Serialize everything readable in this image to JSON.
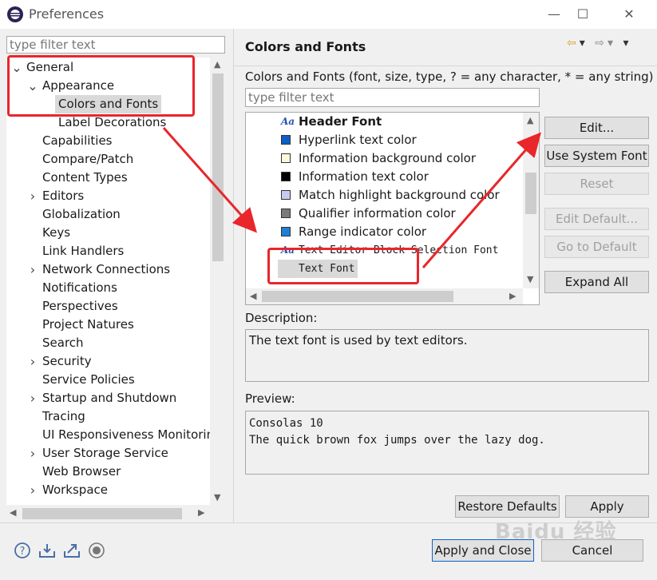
{
  "window": {
    "title": "Preferences",
    "minimize": "—",
    "maximize": "☐",
    "close": "✕"
  },
  "left": {
    "filter_placeholder": "type filter text",
    "tree": [
      {
        "label": "General",
        "depth": 0,
        "expander": "open"
      },
      {
        "label": "Appearance",
        "depth": 1,
        "expander": "open"
      },
      {
        "label": "Colors and Fonts",
        "depth": 2,
        "expander": "none",
        "selected": true
      },
      {
        "label": "Label Decorations",
        "depth": 2,
        "expander": "none"
      },
      {
        "label": "Capabilities",
        "depth": 1,
        "expander": "none"
      },
      {
        "label": "Compare/Patch",
        "depth": 1,
        "expander": "none"
      },
      {
        "label": "Content Types",
        "depth": 1,
        "expander": "none"
      },
      {
        "label": "Editors",
        "depth": 1,
        "expander": "closed"
      },
      {
        "label": "Globalization",
        "depth": 1,
        "expander": "none"
      },
      {
        "label": "Keys",
        "depth": 1,
        "expander": "none"
      },
      {
        "label": "Link Handlers",
        "depth": 1,
        "expander": "none"
      },
      {
        "label": "Network Connections",
        "depth": 1,
        "expander": "closed"
      },
      {
        "label": "Notifications",
        "depth": 1,
        "expander": "none"
      },
      {
        "label": "Perspectives",
        "depth": 1,
        "expander": "none"
      },
      {
        "label": "Project Natures",
        "depth": 1,
        "expander": "none"
      },
      {
        "label": "Search",
        "depth": 1,
        "expander": "none"
      },
      {
        "label": "Security",
        "depth": 1,
        "expander": "closed"
      },
      {
        "label": "Service Policies",
        "depth": 1,
        "expander": "none"
      },
      {
        "label": "Startup and Shutdown",
        "depth": 1,
        "expander": "closed"
      },
      {
        "label": "Tracing",
        "depth": 1,
        "expander": "none"
      },
      {
        "label": "UI Responsiveness Monitoring",
        "depth": 1,
        "expander": "none"
      },
      {
        "label": "User Storage Service",
        "depth": 1,
        "expander": "closed"
      },
      {
        "label": "Web Browser",
        "depth": 1,
        "expander": "none"
      },
      {
        "label": "Workspace",
        "depth": 1,
        "expander": "closed"
      }
    ]
  },
  "page": {
    "title": "Colors and Fonts",
    "description_line": "Colors and Fonts (font, size, type, ? = any character, * = any string) :",
    "filter_placeholder": "type filter text",
    "items": [
      {
        "label": "Header Font",
        "kind": "font",
        "bold": true
      },
      {
        "label": "Hyperlink text color",
        "kind": "color",
        "color": "#0b5fc7"
      },
      {
        "label": "Information background color",
        "kind": "color",
        "color": "#fdf9dd"
      },
      {
        "label": "Information text color",
        "kind": "color",
        "color": "#000000"
      },
      {
        "label": "Match highlight background color",
        "kind": "color",
        "color": "#c8c8f0"
      },
      {
        "label": "Qualifier information color",
        "kind": "color",
        "color": "#7a7a7a"
      },
      {
        "label": "Range indicator color",
        "kind": "color",
        "color": "#1f7fd6"
      },
      {
        "label": "Text Editor Block Selection Font",
        "kind": "font",
        "mono": true
      },
      {
        "label": "Text Font",
        "kind": "font",
        "mono": true,
        "selected": true
      }
    ],
    "buttons": {
      "edit": "Edit...",
      "use_system_font": "Use System Font",
      "reset": "Reset",
      "edit_default": "Edit Default...",
      "go_to_default": "Go to Default",
      "expand_all": "Expand All"
    },
    "description_label": "Description:",
    "description_text": "The text font is used by text editors.",
    "preview_label": "Preview:",
    "preview_text": "Consolas 10\nThe quick brown fox jumps over the lazy dog.",
    "restore_defaults": "Restore Defaults",
    "apply": "Apply"
  },
  "footer": {
    "apply_and_close": "Apply and Close",
    "cancel": "Cancel"
  },
  "watermark": "Baidu 经验",
  "colors": {
    "annotation_red": "#e8262b",
    "selection": "#d9d9d9"
  }
}
